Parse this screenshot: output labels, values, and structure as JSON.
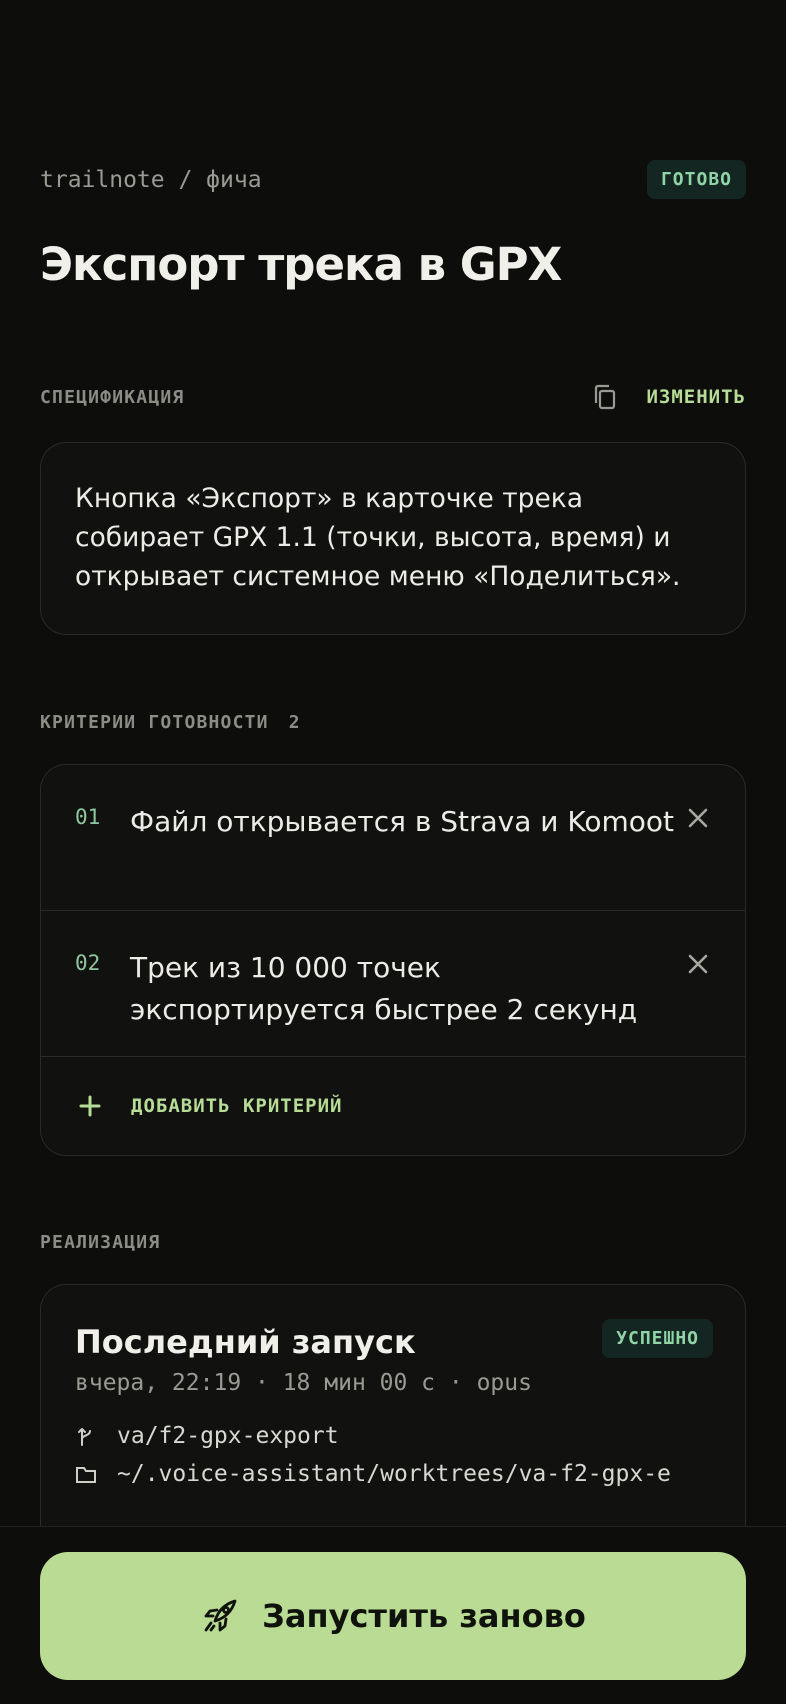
{
  "header": {
    "breadcrumb": "trailnote / фича",
    "status_badge": "ГОТОВО",
    "title": "Экспорт трека в GPX"
  },
  "spec": {
    "label": "СПЕЦИФИКАЦИЯ",
    "copy_icon": "copy-icon",
    "edit_label": "ИЗМЕНИТЬ",
    "text": "Кнопка «Экспорт» в карточке трека собирает GPX 1.1 (точки, высота, время) и открывает системное меню «Поделиться»."
  },
  "criteria": {
    "label": "КРИТЕРИИ ГОТОВНОСТИ",
    "count": "2",
    "items": [
      {
        "num": "01",
        "text": "Файл открывается в Strava и Komoot"
      },
      {
        "num": "02",
        "text": "Трек из 10 000 точек экспортируется быстрее 2 секунд"
      }
    ],
    "add_label": "ДОБАВИТЬ КРИТЕРИЙ"
  },
  "impl": {
    "label": "РЕАЛИЗАЦИЯ",
    "run_title": "Последний запуск",
    "run_status": "УСПЕШНО",
    "run_meta": "вчера, 22:19 · 18 мин 00 с · opus",
    "branch": "va/f2-gpx-export",
    "path": "~/.voice-assistant/worktrees/va-f2-gpx-e"
  },
  "cta": {
    "label": "Запустить заново",
    "icon": "rocket-icon"
  },
  "colors": {
    "background": "#0d0d0c",
    "accent": "#b9db93",
    "success_badge_bg": "#142621",
    "success_badge_text": "#8fd3a6"
  }
}
